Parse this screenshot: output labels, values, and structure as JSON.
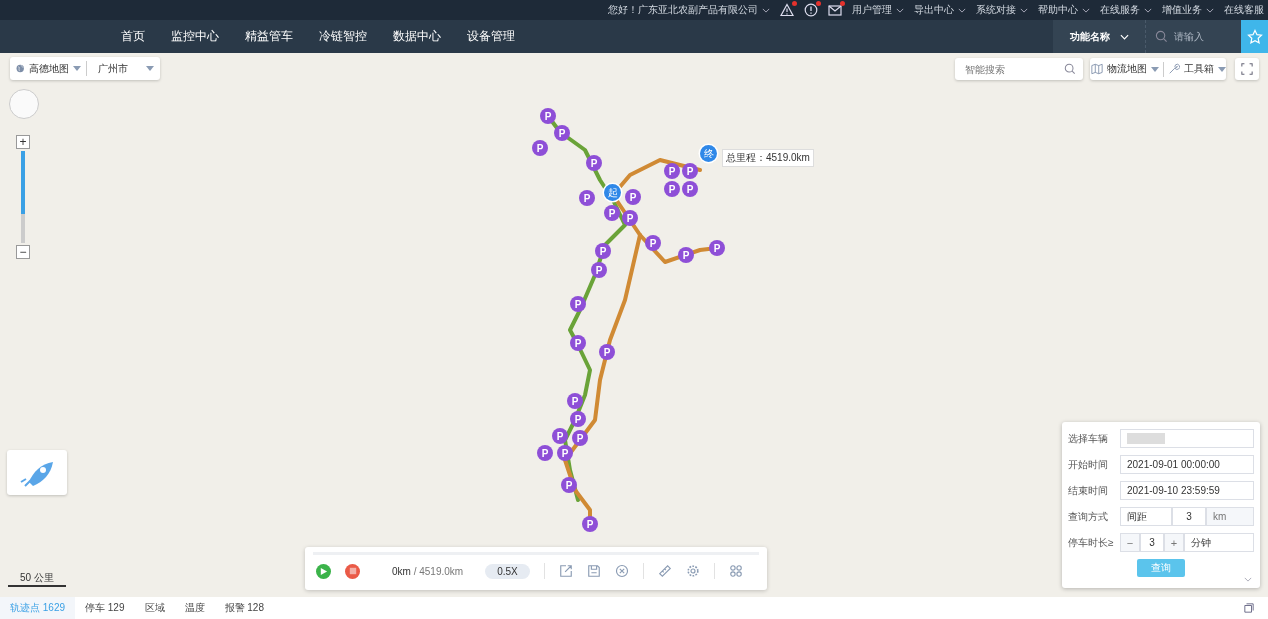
{
  "top_bar": {
    "greeting": "您好！广东亚北农副产品有限公司",
    "alerts": [
      {
        "kind": "warning",
        "dot": true
      },
      {
        "kind": "info",
        "dot": true
      },
      {
        "kind": "mail",
        "dot": true
      }
    ],
    "menus": [
      {
        "label": "用户管理",
        "dropdown": true
      },
      {
        "label": "导出中心",
        "dropdown": true
      },
      {
        "label": "系统对接",
        "dropdown": true
      },
      {
        "label": "帮助中心",
        "dropdown": true
      },
      {
        "label": "在线服务",
        "dropdown": true
      },
      {
        "label": "增值业务",
        "dropdown": true
      },
      {
        "label": "在线客服",
        "dropdown": false
      }
    ]
  },
  "nav": {
    "items": [
      "首页",
      "监控中心",
      "精益管车",
      "冷链智控",
      "数据中心",
      "设备管理"
    ],
    "function_select": "功能名称",
    "search": {
      "placeholder": "请输入"
    }
  },
  "map_controls": {
    "provider": "高德地图",
    "city": "广州市",
    "zoom_in": "+",
    "zoom": {
      "level": 0.68
    },
    "zoom_out": "−",
    "search": {
      "placeholder": "智能搜索"
    },
    "layer": "物流地图",
    "tools": "工具箱",
    "scale": "50 公里"
  },
  "route": {
    "start": "起",
    "end": "终",
    "total": "总里程：4519.0km",
    "parking_markers": [
      "P",
      "P",
      "P",
      "P",
      "P",
      "P",
      "P",
      "P",
      "P",
      "P",
      "P",
      "P",
      "P",
      "P",
      "P",
      "P",
      "P",
      "P",
      "P",
      "P",
      "P",
      "P",
      "P",
      "P",
      "P",
      "P",
      "P",
      "P"
    ]
  },
  "playback": {
    "distance": "0km",
    "total": " / 4519.0km",
    "speed": "0.5X"
  },
  "query_panel": {
    "fields": [
      {
        "kind": "select",
        "label": "选择车辆"
      },
      {
        "kind": "date",
        "label": "开始时间",
        "value": "2021-09-01 00:00:00"
      },
      {
        "kind": "date",
        "label": "结束时间",
        "value": "2021-09-10 23:59:59"
      },
      {
        "kind": "mode",
        "label": "查询方式",
        "value": "间距",
        "amount": "3",
        "unit": "km"
      },
      {
        "kind": "stepper",
        "label": "停车时长≥",
        "minus": "−",
        "value": "3",
        "plus": "+",
        "unit": "分钟"
      }
    ],
    "button": "查询"
  },
  "status_tabs": [
    {
      "label": "轨迹点 1629",
      "selected": true
    },
    {
      "label": "停车 129",
      "selected": false
    },
    {
      "label": "区域",
      "selected": false
    },
    {
      "label": "温度",
      "selected": false
    },
    {
      "label": "报警 128",
      "selected": false
    }
  ]
}
